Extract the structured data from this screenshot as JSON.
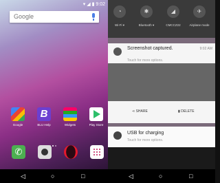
{
  "left_phone": {
    "status_icons": "▾ ◢ ▮ 9:02",
    "search": {
      "brand": "Google"
    },
    "apps": [
      "Google",
      "BLU Help",
      "Widgets",
      "Play Store"
    ],
    "dock": [
      "Phone",
      "Camera",
      "Opera",
      "Apps"
    ],
    "nav": {
      "back": "◁",
      "home": "○",
      "recent": "□"
    }
  },
  "right_phone": {
    "quick_settings": [
      "Wi-Fi ▾",
      "Bluetooth ▾",
      "CMCCZ22",
      "Airplane mode"
    ],
    "notification": {
      "title": "Screenshot captured.",
      "time": "9:02 AM",
      "sub": "Touch for more options."
    },
    "actions": {
      "share": "SHARE",
      "delete": "DELETE"
    },
    "usb": {
      "title": "USB for charging",
      "sub": "Touch for more options."
    },
    "nav": {
      "back": "◁",
      "home": "○",
      "recent": "□"
    }
  }
}
